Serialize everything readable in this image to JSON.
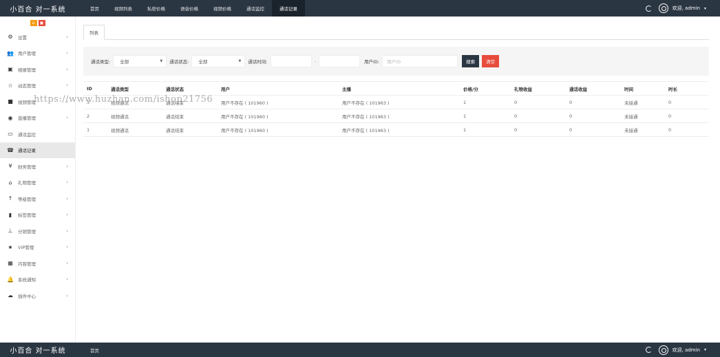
{
  "brand": "小百合 对一系统",
  "nav": [
    "首页",
    "视频列表",
    "私密价格",
    "语音价格",
    "视频价格",
    "通话监控",
    "通话记录"
  ],
  "nav_active_index": 6,
  "user": {
    "label": "欢迎, admin",
    "caret": "▾"
  },
  "sidebar": {
    "toggles": [
      "⌂",
      "▣"
    ],
    "items": [
      {
        "label": "设置",
        "icon": "gears-icon",
        "glyph": "⚙",
        "arrow": true
      },
      {
        "label": "用户管理",
        "icon": "users-icon",
        "glyph": "👥",
        "arrow": true
      },
      {
        "label": "相册管理",
        "icon": "picture-icon",
        "glyph": "▣",
        "arrow": true
      },
      {
        "label": "动态管理",
        "icon": "star-icon",
        "glyph": "☆",
        "arrow": true
      },
      {
        "label": "视频管理",
        "icon": "video-icon",
        "glyph": "■",
        "arrow": true
      },
      {
        "label": "直播管理",
        "icon": "play-circle-icon",
        "glyph": "◉",
        "arrow": true
      },
      {
        "label": "通话监控",
        "icon": "monitor-icon",
        "glyph": "▭",
        "arrow": false
      },
      {
        "label": "通话记录",
        "icon": "phone-icon",
        "glyph": "☎",
        "arrow": false,
        "active": true
      },
      {
        "label": "财务管理",
        "icon": "yen-icon",
        "glyph": "¥",
        "arrow": true
      },
      {
        "label": "礼物管理",
        "icon": "gift-icon",
        "glyph": "⌂",
        "arrow": true
      },
      {
        "label": "等级管理",
        "icon": "level-up-icon",
        "glyph": "↑",
        "arrow": true
      },
      {
        "label": "标签管理",
        "icon": "bookmark-icon",
        "glyph": "▮",
        "arrow": true
      },
      {
        "label": "分销管理",
        "icon": "sitemap-icon",
        "glyph": "⊥",
        "arrow": true
      },
      {
        "label": "VIP管理",
        "icon": "star-filled-icon",
        "glyph": "★",
        "arrow": true
      },
      {
        "label": "内容管理",
        "icon": "grid-icon",
        "glyph": "▦",
        "arrow": true
      },
      {
        "label": "系统通知",
        "icon": "bell-icon",
        "glyph": "🔔",
        "arrow": true
      },
      {
        "label": "插件中心",
        "icon": "cloud-icon",
        "glyph": "☁",
        "arrow": true
      }
    ],
    "arrow_glyph": "›"
  },
  "tab": "列表",
  "filters": {
    "type_label": "通话类型:",
    "type_value": "全部",
    "status_label": "通话状态:",
    "status_value": "全部",
    "time_label": "通话时间:",
    "time_dash": "-",
    "uid_label": "用户ID:",
    "uid_placeholder": "用户ID",
    "search_btn": "搜索",
    "clear_btn": "清空",
    "caret": "▼"
  },
  "table": {
    "headers": [
      "ID",
      "通话类型",
      "通话状态",
      "用户",
      "主播",
      "价格/分",
      "礼物收益",
      "通话收益",
      "时间",
      "时长"
    ],
    "rows": [
      [
        "3",
        "视频通话",
        "通话结束",
        "用户不存在 ( 101960 )",
        "用户不存在 ( 101963 )",
        "1",
        "0",
        "0",
        "未接通",
        "0"
      ],
      [
        "2",
        "视频通话",
        "通话结束",
        "用户不存在 ( 101960 )",
        "用户不存在 ( 101963 )",
        "1",
        "0",
        "0",
        "未接通",
        "0"
      ],
      [
        "1",
        "视频通话",
        "通话结束",
        "用户不存在 ( 101960 )",
        "用户不存在 ( 101963 )",
        "1",
        "0",
        "0",
        "未接通",
        "0"
      ]
    ]
  },
  "watermark": "https://www.huzhan.com/ishop21756",
  "footer": {
    "brand": "小百合 对一系统",
    "nav": "首页",
    "user": "欢迎, admin",
    "caret": "▾"
  }
}
